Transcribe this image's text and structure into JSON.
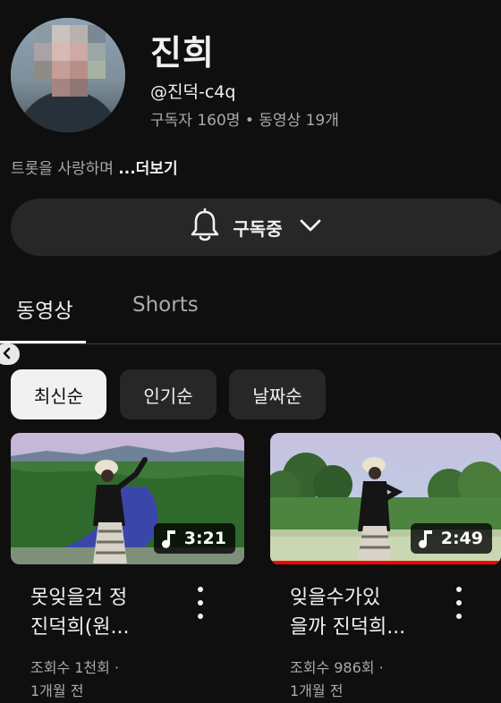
{
  "channel": {
    "name": "진희",
    "handle": "@진덕-c4q",
    "stats": "구독자 160명 • 동영상 19개",
    "description": "트롯을 사랑하며 ",
    "more_label": "...더보기"
  },
  "subscribe": {
    "label": "구독중",
    "icon": "bell-icon"
  },
  "tabs": [
    {
      "label": "동영상",
      "active": true
    },
    {
      "label": "Shorts",
      "active": false
    }
  ],
  "chips": [
    {
      "label": "최신순",
      "active": true
    },
    {
      "label": "인기순",
      "active": false
    },
    {
      "label": "날짜순",
      "active": false
    }
  ],
  "videos": [
    {
      "duration": "3:21",
      "title_line1": "못잊을건 정",
      "title_line2": "진덕희(원...",
      "views": "조회수 1천회 ·",
      "age": "1개월 전",
      "watched_fraction": 0
    },
    {
      "duration": "2:49",
      "title_line1": "잊을수가있",
      "title_line2": "을까 진덕희...",
      "views": "조회수 986회 ·",
      "age": "1개월 전",
      "watched_fraction": 1
    }
  ],
  "colors": {
    "background": "#0f0f0f",
    "surface": "#272727",
    "progress": "#ff0000",
    "muted": "#aaaaaa"
  }
}
